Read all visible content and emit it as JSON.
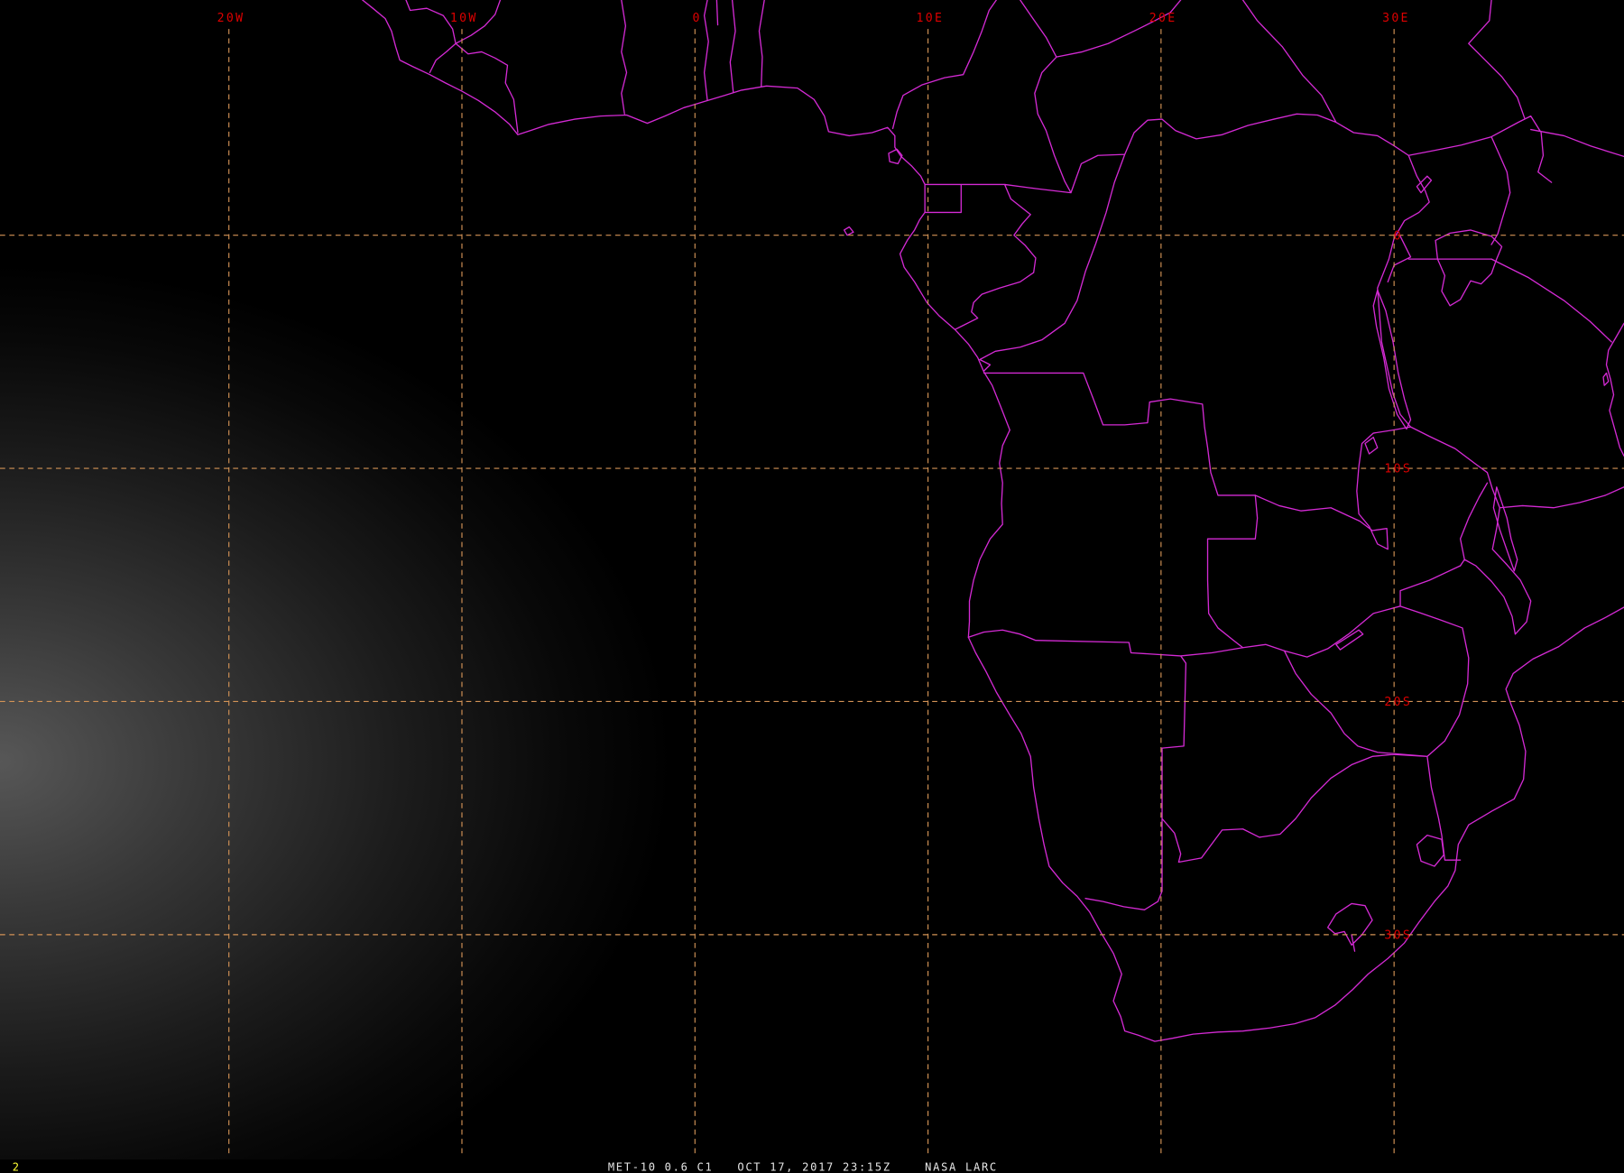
{
  "graticule": {
    "longitudes": [
      {
        "value": -20,
        "label": "20W"
      },
      {
        "value": -10,
        "label": "10W"
      },
      {
        "value": 0,
        "label": "0"
      },
      {
        "value": 10,
        "label": "10E"
      },
      {
        "value": 20,
        "label": "20E"
      },
      {
        "value": 30,
        "label": "30E"
      }
    ],
    "latitudes": [
      {
        "value": 0,
        "label": "0"
      },
      {
        "value": -10,
        "label": "10S"
      },
      {
        "value": -20,
        "label": "20S"
      },
      {
        "value": -30,
        "label": "30S"
      }
    ]
  },
  "status_bar": {
    "frame_indicator": "2",
    "product": "MET-10 0.6 C1",
    "datetime": "OCT 17, 2017 23:15Z",
    "source": "NASA LARC"
  },
  "colors": {
    "background": "#000000",
    "grid_line": "#d39356",
    "grid_label": "#dd0000",
    "boundaries": "#d42ad4",
    "status_text": "#e6e6e6",
    "frame_indicator": "#ffff33"
  }
}
